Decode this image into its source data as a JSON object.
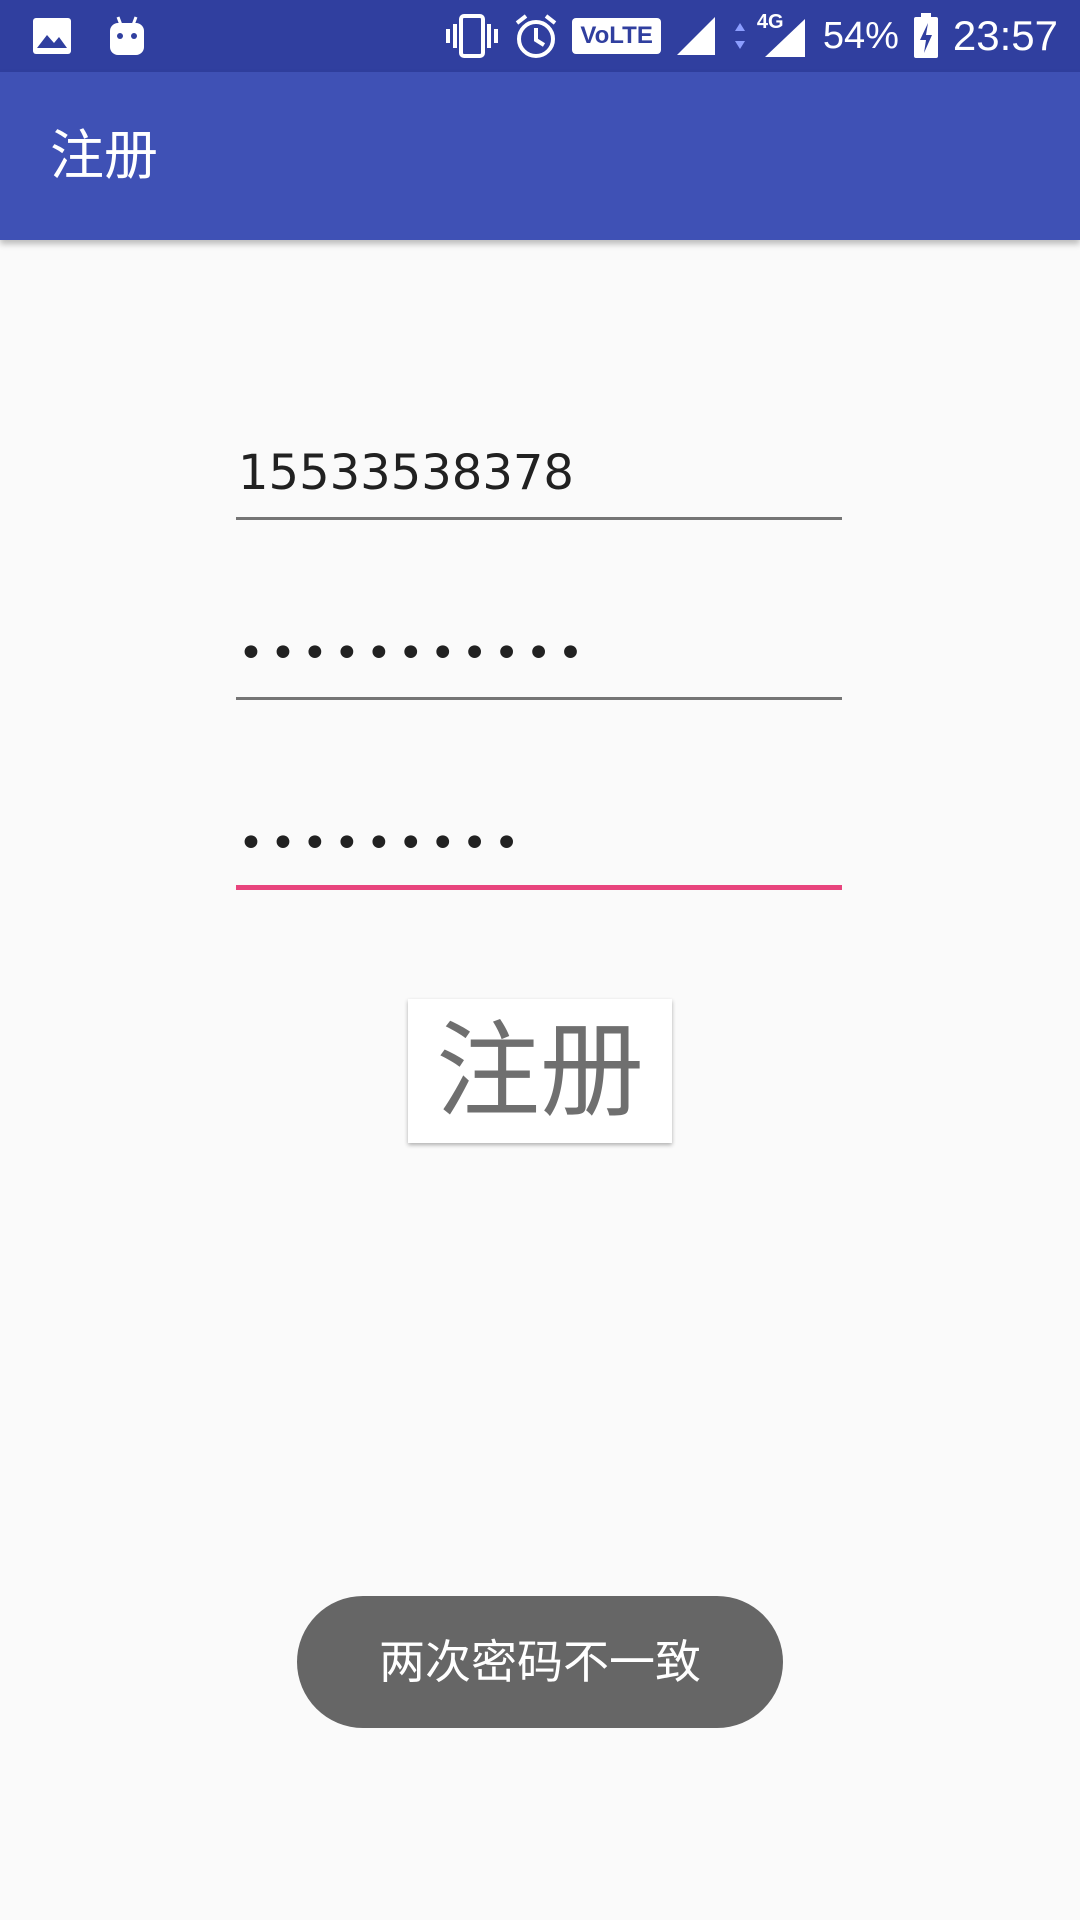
{
  "status_bar": {
    "battery": "54%",
    "network": "4G",
    "volte": "VoLTE",
    "time": "23:57",
    "icons": [
      "image-icon",
      "android-icon",
      "vibrate-icon",
      "alarm-icon",
      "volte-icon",
      "signal-icon",
      "data-arrows-icon",
      "signal-4g-icon",
      "battery-charging-icon"
    ]
  },
  "app_bar": {
    "title": "注册"
  },
  "form": {
    "phone_value": "15533538378",
    "password_value": "•••••••••••",
    "confirm_password_value": "•••••••••",
    "register_label": "注册"
  },
  "toast": {
    "message": "两次密码不一致"
  },
  "colors": {
    "status_bar": "#303f9f",
    "app_bar": "#3f51b5",
    "accent": "#e8447d",
    "background": "#fafafa",
    "toast_bg": "#666666"
  }
}
